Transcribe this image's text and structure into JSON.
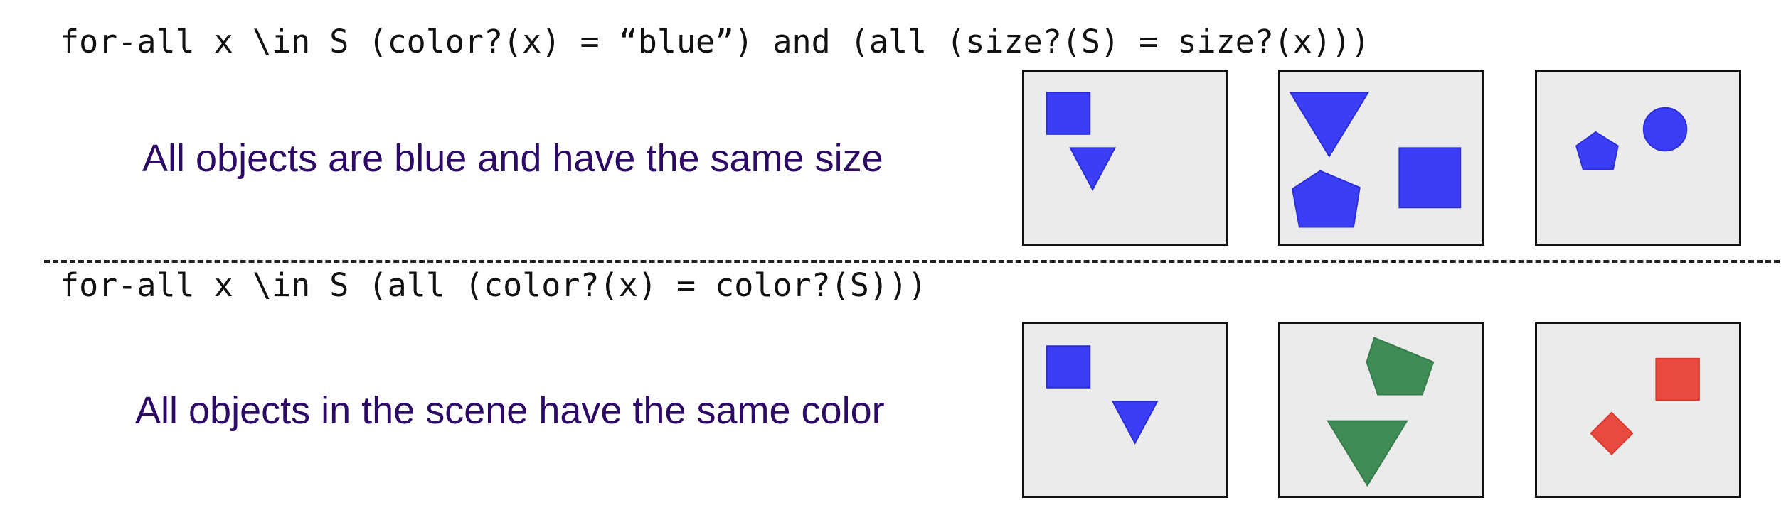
{
  "rows": [
    {
      "formula": "for-all x \\in S (color?(x) = “blue”) and (all (size?(S) = size?(x)))",
      "description": "All objects are blue and have the same size"
    },
    {
      "formula": "for-all x \\in S (all (color?(x) = color?(S)))",
      "description": "All objects in the scene have the same color"
    }
  ],
  "colors": {
    "blue": "#3b3ef5",
    "blue_stroke": "#2a2dd6",
    "green": "#3f8c57",
    "green_stroke": "#357a4a",
    "red": "#e94a40",
    "red_stroke": "#d63a30",
    "scene_background": "#ebebeb",
    "description_text": "#2c0a66"
  }
}
